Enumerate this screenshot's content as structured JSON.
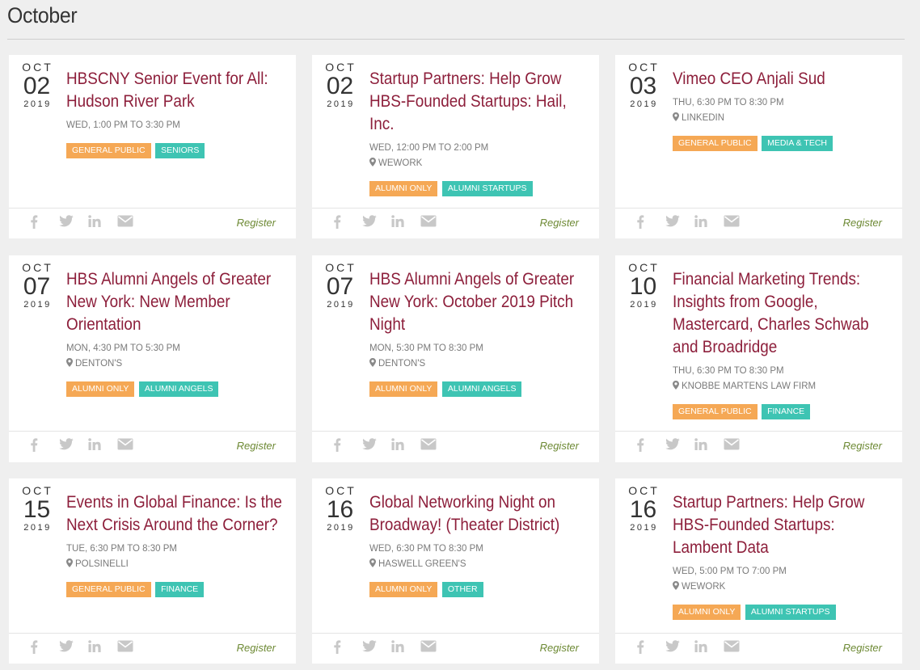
{
  "month": "October",
  "share_labels": {
    "facebook": "facebook-icon",
    "twitter": "twitter-icon",
    "linkedin": "linkedin-icon",
    "email": "email-icon"
  },
  "colors": {
    "title": "#8d1f3b",
    "tag_orange": "#f5a855",
    "tag_teal": "#3ec4b3",
    "register": "#6e8a35"
  },
  "events": [
    {
      "month": "OCT",
      "day": "02",
      "year": "2019",
      "title": "HBSCNY Senior Event for All: Hudson River Park",
      "time": "WED, 1:00 PM TO 3:30 PM",
      "location": "",
      "tags": [
        {
          "label": "GENERAL PUBLIC",
          "color": "orange"
        },
        {
          "label": "SENIORS",
          "color": "teal"
        }
      ],
      "register": "Register"
    },
    {
      "month": "OCT",
      "day": "02",
      "year": "2019",
      "title": "Startup Partners: Help Grow HBS-Founded Startups: Hail, Inc.",
      "time": "WED, 12:00 PM TO 2:00 PM",
      "location": "WEWORK",
      "tags": [
        {
          "label": "ALUMNI ONLY",
          "color": "orange"
        },
        {
          "label": "ALUMNI STARTUPS",
          "color": "teal"
        }
      ],
      "register": "Register"
    },
    {
      "month": "OCT",
      "day": "03",
      "year": "2019",
      "title": "Vimeo CEO Anjali Sud",
      "time": "THU, 6:30 PM TO 8:30 PM",
      "location": "LINKEDIN",
      "tags": [
        {
          "label": "GENERAL PUBLIC",
          "color": "orange"
        },
        {
          "label": "MEDIA & TECH",
          "color": "teal"
        }
      ],
      "register": "Register"
    },
    {
      "month": "OCT",
      "day": "07",
      "year": "2019",
      "title": "HBS Alumni Angels of Greater New York: New Member Orientation",
      "time": "MON, 4:30 PM TO 5:30 PM",
      "location": "DENTON'S",
      "tags": [
        {
          "label": "ALUMNI ONLY",
          "color": "orange"
        },
        {
          "label": "ALUMNI ANGELS",
          "color": "teal"
        }
      ],
      "register": "Register"
    },
    {
      "month": "OCT",
      "day": "07",
      "year": "2019",
      "title": "HBS Alumni Angels of Greater New York: October 2019 Pitch Night",
      "time": "MON, 5:30 PM TO 8:30 PM",
      "location": "DENTON'S",
      "tags": [
        {
          "label": "ALUMNI ONLY",
          "color": "orange"
        },
        {
          "label": "ALUMNI ANGELS",
          "color": "teal"
        }
      ],
      "register": "Register"
    },
    {
      "month": "OCT",
      "day": "10",
      "year": "2019",
      "title": "Financial Marketing Trends: Insights from Google, Mastercard, Charles Schwab and Broadridge",
      "time": "THU, 6:30 PM TO 8:30 PM",
      "location": "KNOBBE MARTENS LAW FIRM",
      "tags": [
        {
          "label": "GENERAL PUBLIC",
          "color": "orange"
        },
        {
          "label": "FINANCE",
          "color": "teal"
        }
      ],
      "register": "Register"
    },
    {
      "month": "OCT",
      "day": "15",
      "year": "2019",
      "title": "Events in Global Finance: Is the Next Crisis Around the Corner?",
      "time": "TUE, 6:30 PM TO 8:30 PM",
      "location": "POLSINELLI",
      "tags": [
        {
          "label": "GENERAL PUBLIC",
          "color": "orange"
        },
        {
          "label": "FINANCE",
          "color": "teal"
        }
      ],
      "register": "Register"
    },
    {
      "month": "OCT",
      "day": "16",
      "year": "2019",
      "title": "Global Networking Night on Broadway! (Theater District)",
      "time": "WED, 6:30 PM TO 8:30 PM",
      "location": "HASWELL GREEN'S",
      "tags": [
        {
          "label": "ALUMNI ONLY",
          "color": "orange"
        },
        {
          "label": "OTHER",
          "color": "teal"
        }
      ],
      "register": "Register"
    },
    {
      "month": "OCT",
      "day": "16",
      "year": "2019",
      "title": "Startup Partners: Help Grow HBS-Founded Startups: Lambent Data",
      "time": "WED, 5:00 PM TO 7:00 PM",
      "location": "WEWORK",
      "tags": [
        {
          "label": "ALUMNI ONLY",
          "color": "orange"
        },
        {
          "label": "ALUMNI STARTUPS",
          "color": "teal"
        }
      ],
      "register": "Register"
    }
  ]
}
